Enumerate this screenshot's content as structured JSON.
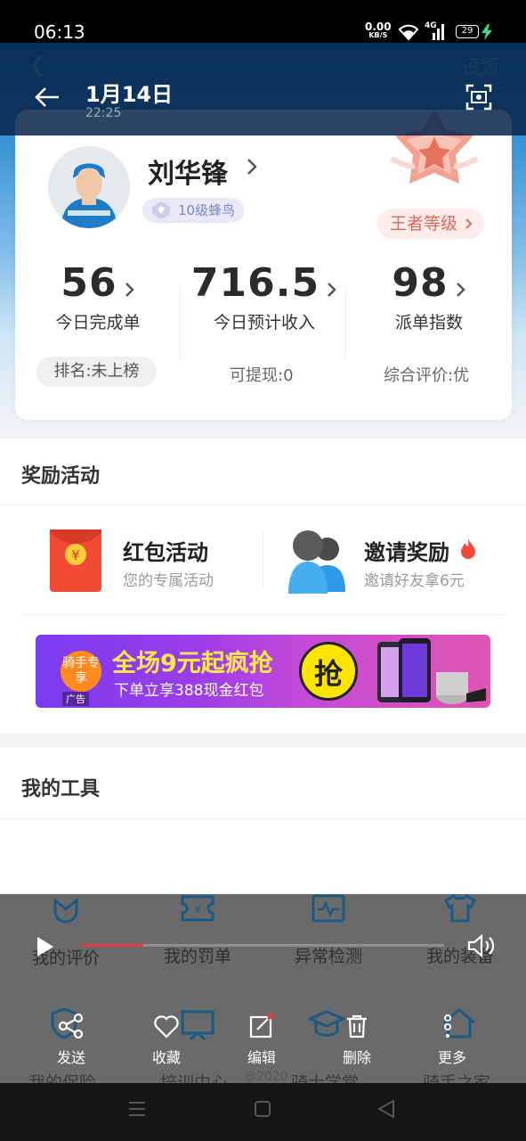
{
  "status_bar": {
    "time": "06:13",
    "net_speed": "0.00",
    "net_unit": "KB/S",
    "network": "4G",
    "battery": "29"
  },
  "ghost_header": {
    "settings": "设置"
  },
  "overlay": {
    "date": "1月14日",
    "time": "22:25"
  },
  "profile": {
    "name": "刘华锋",
    "level": "10级蜂鸟",
    "tier": "王者等级",
    "stats": [
      {
        "value": "56",
        "label": "今日完成单",
        "sub": "排名:未上榜"
      },
      {
        "value": "716.5",
        "label": "今日预计收入",
        "sub": "可提现:0"
      },
      {
        "value": "98",
        "label": "派单指数",
        "sub": "综合评价:优"
      }
    ]
  },
  "rewards": {
    "title": "奖励活动",
    "items": [
      {
        "title": "红包活动",
        "subtitle": "您的专属活动"
      },
      {
        "title": "邀请奖励",
        "subtitle": "邀请好友拿6元"
      }
    ],
    "banner": {
      "badge": "骑手专享",
      "headline": "全场9元起疯抢",
      "subline": "下单立享388现金红包",
      "grab": "抢",
      "ad": "广告"
    }
  },
  "tools": {
    "title": "我的工具",
    "row1": [
      "我的评价",
      "我的罚单",
      "异常检测",
      "我的装备"
    ],
    "row2": [
      "我的保险",
      "培训中心",
      "骑士学堂",
      "骑手之家"
    ],
    "watermark": "@2020"
  },
  "media": {
    "progress": 0.17,
    "actions": [
      "发送",
      "收藏",
      "编辑",
      "删除",
      "更多"
    ]
  },
  "colors": {
    "accent_red": "#e63946",
    "header_blue": "#1f7fc6",
    "tier_text": "#e0695b"
  }
}
